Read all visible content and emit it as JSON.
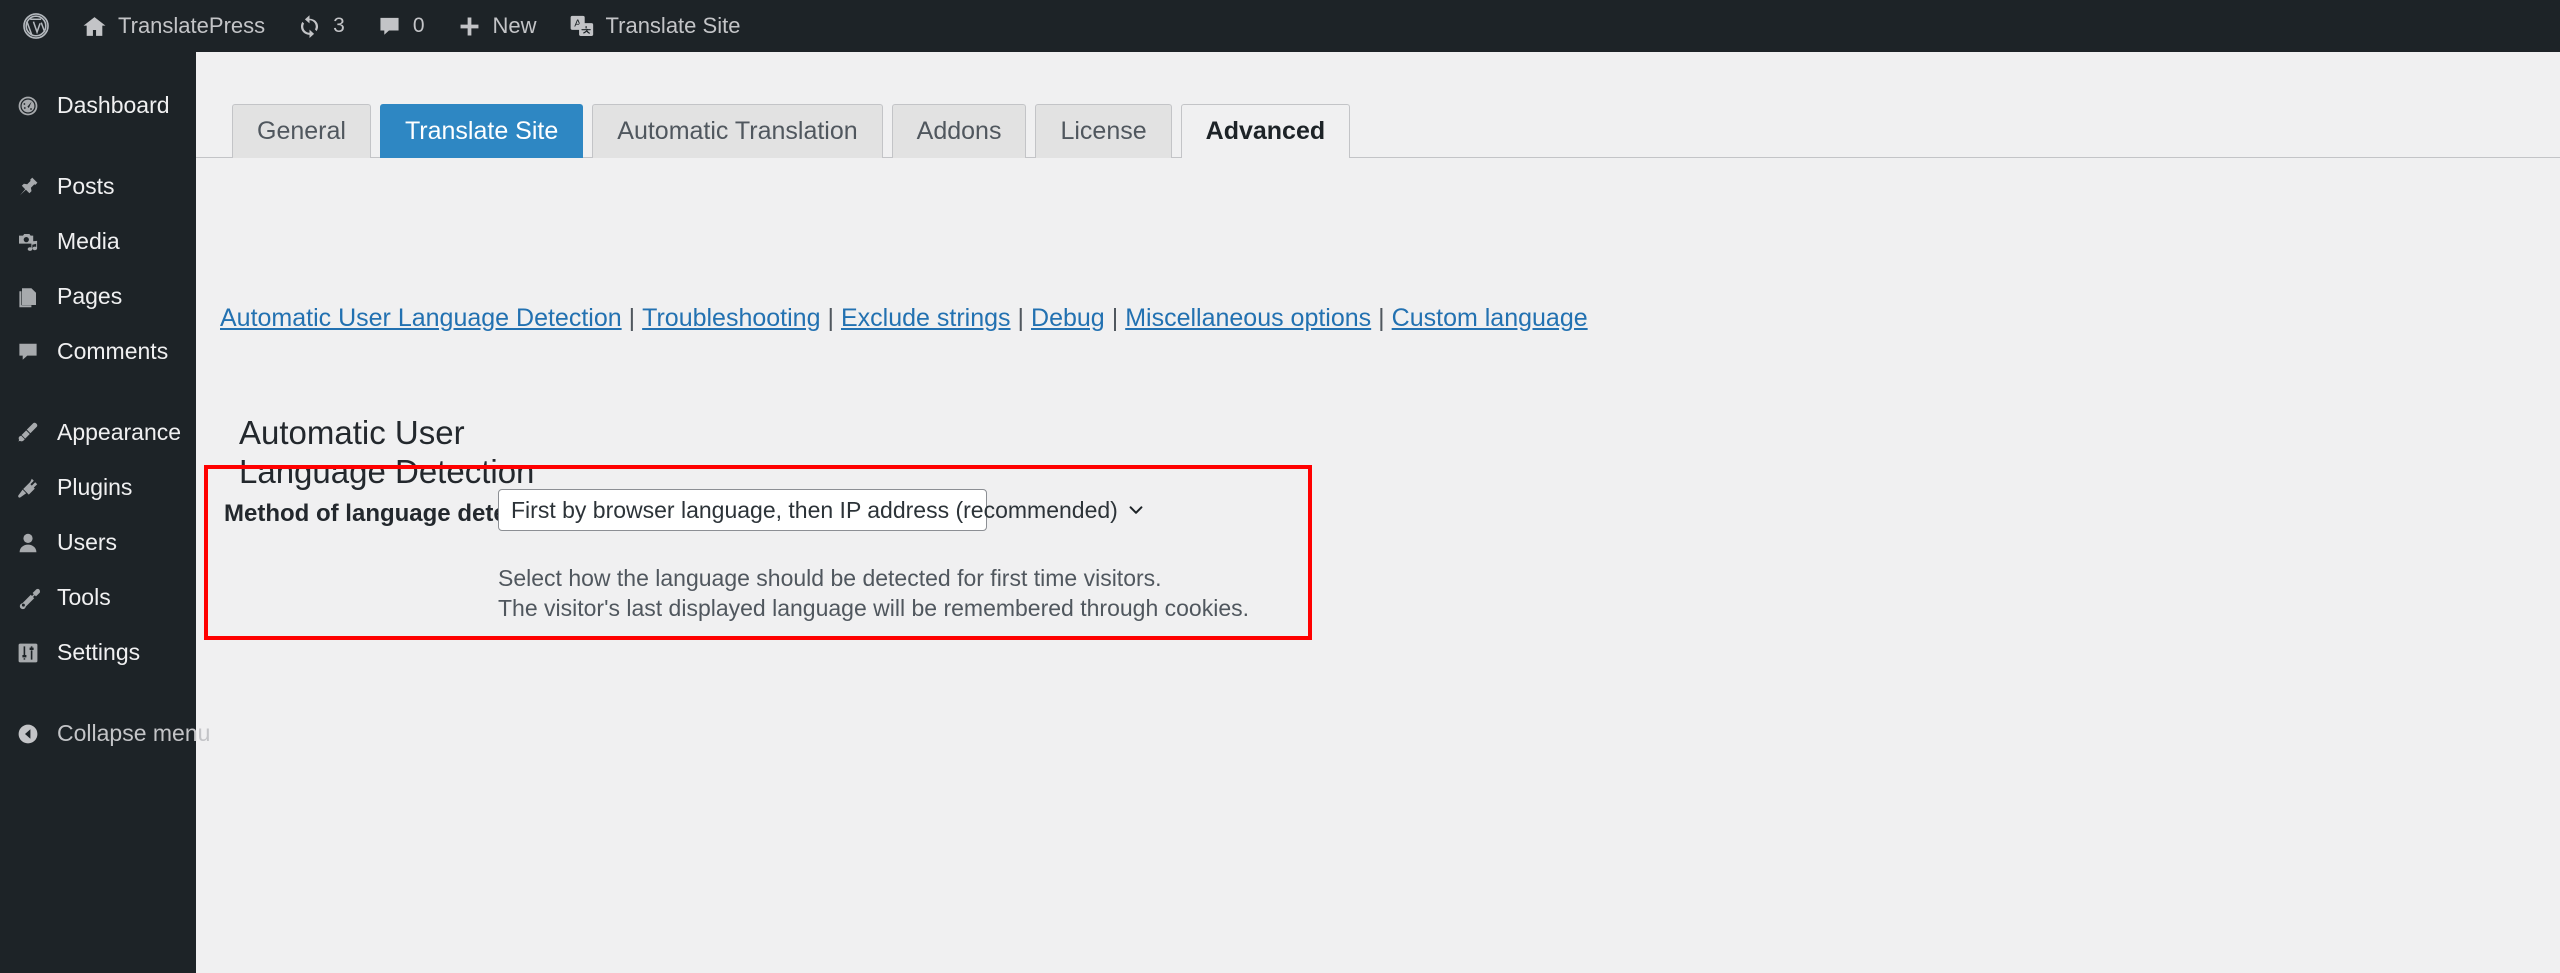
{
  "adminbar": {
    "items": [
      {
        "icon": "wordpress-logo-icon",
        "label": ""
      },
      {
        "icon": "home-icon",
        "label": "TranslatePress"
      },
      {
        "icon": "updates-icon",
        "label": "3"
      },
      {
        "icon": "comment-bubble-icon",
        "label": "0"
      },
      {
        "icon": "plus-icon",
        "label": "New"
      },
      {
        "icon": "translate-icon",
        "label": "Translate Site"
      }
    ]
  },
  "sidebar": {
    "items": [
      {
        "label": "Dashboard",
        "icon": "dashboard-gauge-icon"
      },
      {
        "label": "Posts",
        "icon": "pin-icon"
      },
      {
        "label": "Media",
        "icon": "media-camera-music-icon"
      },
      {
        "label": "Pages",
        "icon": "pages-icon"
      },
      {
        "label": "Comments",
        "icon": "comment-bubble-icon"
      },
      {
        "label": "Appearance",
        "icon": "paintbrush-icon"
      },
      {
        "label": "Plugins",
        "icon": "plug-icon"
      },
      {
        "label": "Users",
        "icon": "user-icon"
      },
      {
        "label": "Tools",
        "icon": "wrench-icon"
      },
      {
        "label": "Settings",
        "icon": "sliders-icon"
      }
    ],
    "collapse": {
      "label": "Collapse menu",
      "icon": "collapse-arrow-icon"
    }
  },
  "tabs": [
    {
      "label": "General",
      "state": "normal"
    },
    {
      "label": "Translate Site",
      "state": "blue"
    },
    {
      "label": "Automatic Translation",
      "state": "normal"
    },
    {
      "label": "Addons",
      "state": "normal"
    },
    {
      "label": "License",
      "state": "normal"
    },
    {
      "label": "Advanced",
      "state": "active"
    }
  ],
  "sublinks": [
    "Automatic User Language Detection",
    "Troubleshooting",
    "Exclude strings",
    "Debug",
    "Miscellaneous options",
    "Custom language"
  ],
  "sublink_separator": "|",
  "section": {
    "title": "Automatic User\nLanguage Detection"
  },
  "field": {
    "label": "Method of language detection",
    "selected_value": "First by browser language, then IP address (recommended)",
    "options": [
      "First by browser language, then IP address (recommended)"
    ],
    "description": "Select how the language should be detected for first time visitors.\nThe visitor's last displayed language will be remembered through cookies."
  },
  "colors": {
    "admin_dark": "#1d2327",
    "content_bg": "#f0f0f1",
    "link_blue": "#2271b1",
    "tab_blue": "#2e87c3",
    "highlight_red": "#ff0000"
  }
}
